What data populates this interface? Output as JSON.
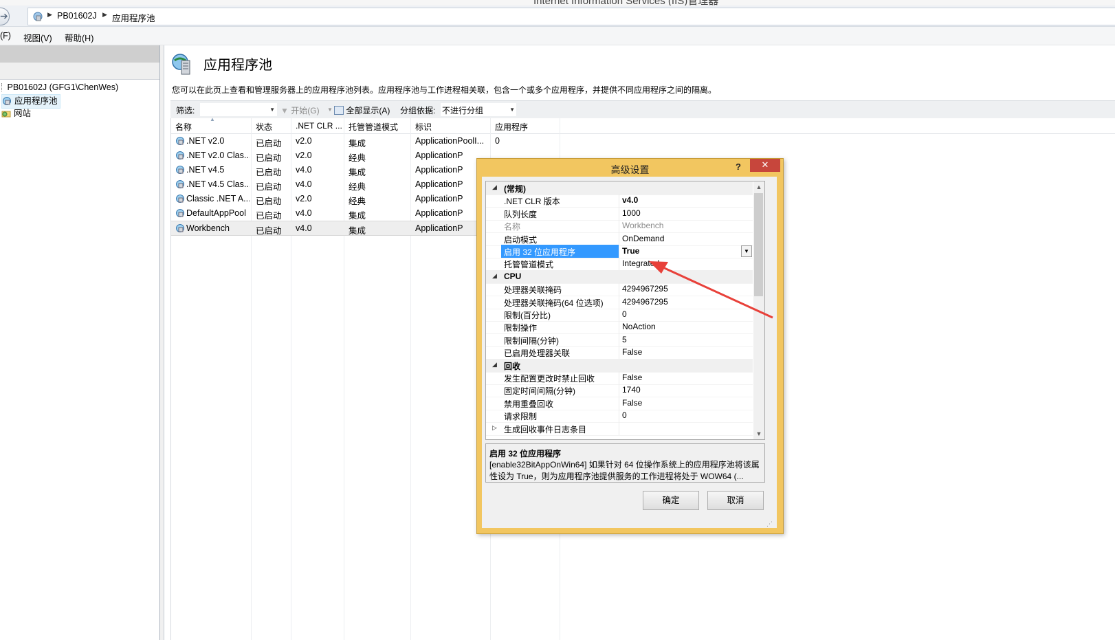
{
  "window": {
    "title": "Internet Information Services (IIS)管理器"
  },
  "address": {
    "crumbs": [
      "PB01602J",
      "应用程序池"
    ]
  },
  "menu": {
    "items": [
      "(F)",
      "视图(V)",
      "帮助(H)"
    ]
  },
  "tree": {
    "server": "PB01602J (GFG1\\ChenWes)",
    "items": [
      "应用程序池",
      "网站"
    ]
  },
  "page": {
    "title": "应用程序池",
    "description": "您可以在此页上查看和管理服务器上的应用程序池列表。应用程序池与工作进程相关联，包含一个或多个应用程序，并提供不同应用程序之间的隔离。"
  },
  "filterbar": {
    "filter_label": "筛选:",
    "start_label": "开始(G)",
    "show_all_label": "全部显示(A)",
    "group_label": "分组依据:",
    "group_value": "不进行分组"
  },
  "grid": {
    "columns": [
      "名称",
      "状态",
      ".NET CLR ...",
      "托管管道模式",
      "标识",
      "应用程序"
    ],
    "rows": [
      [
        ".NET v2.0",
        "已启动",
        "v2.0",
        "集成",
        "ApplicationPoolI...",
        "0"
      ],
      [
        ".NET v2.0 Clas...",
        "已启动",
        "v2.0",
        "经典",
        "ApplicationP",
        ""
      ],
      [
        ".NET v4.5",
        "已启动",
        "v4.0",
        "集成",
        "ApplicationP",
        ""
      ],
      [
        ".NET v4.5 Clas...",
        "已启动",
        "v4.0",
        "经典",
        "ApplicationP",
        ""
      ],
      [
        "Classic .NET A...",
        "已启动",
        "v2.0",
        "经典",
        "ApplicationP",
        ""
      ],
      [
        "DefaultAppPool",
        "已启动",
        "v4.0",
        "集成",
        "ApplicationP",
        ""
      ],
      [
        "Workbench",
        "已启动",
        "v4.0",
        "集成",
        "ApplicationP",
        ""
      ]
    ],
    "selected_row": "Workbench"
  },
  "dialog": {
    "title": "高级设置",
    "help": "?",
    "close": "✕",
    "properties": [
      {
        "type": "category",
        "name": "(常规)",
        "expanded": true
      },
      {
        "type": "prop",
        "name": ".NET CLR 版本",
        "value": "v4.0",
        "bold": true
      },
      {
        "type": "prop",
        "name": "队列长度",
        "value": "1000"
      },
      {
        "type": "prop",
        "name": "名称",
        "value": "Workbench",
        "disabled": true
      },
      {
        "type": "prop",
        "name": "启动模式",
        "value": "OnDemand"
      },
      {
        "type": "prop",
        "name": "启用 32 位应用程序",
        "value": "True",
        "selected": true
      },
      {
        "type": "prop",
        "name": "托管管道模式",
        "value": "Integrated"
      },
      {
        "type": "category",
        "name": "CPU",
        "expanded": true
      },
      {
        "type": "prop",
        "name": "处理器关联掩码",
        "value": "4294967295"
      },
      {
        "type": "prop",
        "name": "处理器关联掩码(64 位选项)",
        "value": "4294967295"
      },
      {
        "type": "prop",
        "name": "限制(百分比)",
        "value": "0"
      },
      {
        "type": "prop",
        "name": "限制操作",
        "value": "NoAction"
      },
      {
        "type": "prop",
        "name": "限制间隔(分钟)",
        "value": "5"
      },
      {
        "type": "prop",
        "name": "已启用处理器关联",
        "value": "False"
      },
      {
        "type": "category",
        "name": "回收",
        "expanded": true
      },
      {
        "type": "prop",
        "name": "发生配置更改时禁止回收",
        "value": "False"
      },
      {
        "type": "prop",
        "name": "固定时间间隔(分钟)",
        "value": "1740"
      },
      {
        "type": "prop",
        "name": "禁用重叠回收",
        "value": "False"
      },
      {
        "type": "prop",
        "name": "请求限制",
        "value": "0"
      },
      {
        "type": "subcat",
        "name": "生成回收事件日志条目",
        "value": ""
      }
    ],
    "description_title": "启用 32 位应用程序",
    "description_text": "[enable32BitAppOnWin64] 如果针对 64 位操作系统上的应用程序池将该属性设为 True，则为应用程序池提供服务的工作进程将处于 WOW64 (...",
    "ok_label": "确定",
    "cancel_label": "取消"
  },
  "colors": {
    "dialog_frame": "#f2c660",
    "close_button": "#c7463c",
    "selection": "#3399ff",
    "annotation_arrow": "#e8413a"
  }
}
